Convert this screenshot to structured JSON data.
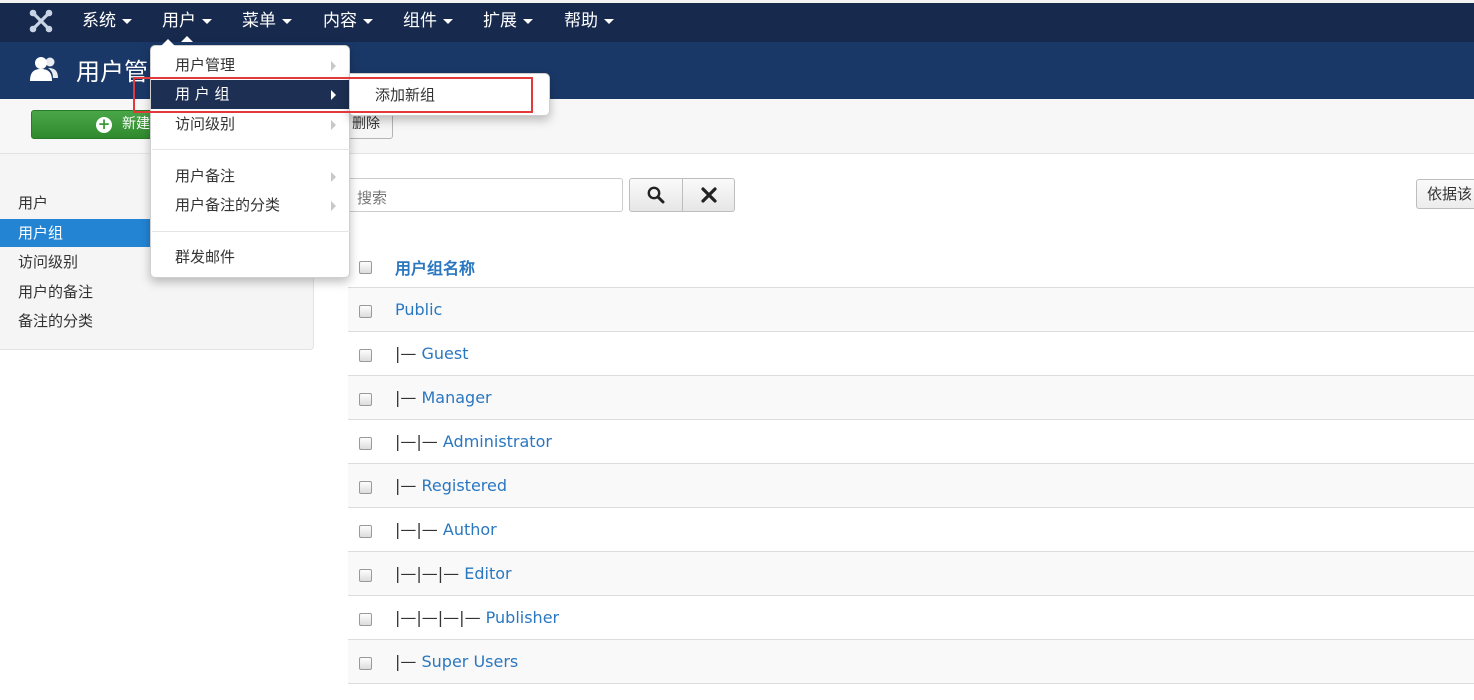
{
  "navbar": {
    "logo_icon": "joomla-logo-icon",
    "items": [
      {
        "label": "系统"
      },
      {
        "label": "用户"
      },
      {
        "label": "菜单"
      },
      {
        "label": "内容"
      },
      {
        "label": "组件"
      },
      {
        "label": "扩展"
      },
      {
        "label": "帮助"
      }
    ],
    "open_item": "用户"
  },
  "header": {
    "icon": "users-icon",
    "title": "用户管"
  },
  "toolbar": {
    "new_label": "新建",
    "delete_label": "删除"
  },
  "sidebar": {
    "items": [
      {
        "label": "用户"
      },
      {
        "label": "用户组",
        "active": true
      },
      {
        "label": "访问级别"
      },
      {
        "label": "用户的备注"
      },
      {
        "label": "备注的分类"
      }
    ]
  },
  "search": {
    "placeholder": "搜索",
    "sort_label": "依据该"
  },
  "table": {
    "column_title": "用户组名称",
    "rows": [
      {
        "prefix": "",
        "name": "Public"
      },
      {
        "prefix": "|— ",
        "name": "Guest"
      },
      {
        "prefix": "|— ",
        "name": "Manager"
      },
      {
        "prefix": "|—|— ",
        "name": "Administrator"
      },
      {
        "prefix": "|— ",
        "name": "Registered"
      },
      {
        "prefix": "|—|— ",
        "name": "Author"
      },
      {
        "prefix": "|—|—|— ",
        "name": "Editor"
      },
      {
        "prefix": "|—|—|—|— ",
        "name": "Publisher"
      },
      {
        "prefix": "|— ",
        "name": "Super Users"
      }
    ]
  },
  "dropdown": {
    "items": [
      {
        "label": "用户管理",
        "has_submenu": true
      },
      {
        "label": "用 户 组",
        "has_submenu": true,
        "active": true
      },
      {
        "label": "访问级别",
        "has_submenu": true
      },
      {
        "label": "用户备注",
        "has_submenu": true
      },
      {
        "label": "用户备注的分类",
        "has_submenu": true
      },
      {
        "label": "群发邮件",
        "has_submenu": false
      }
    ],
    "submenu": {
      "items": [
        {
          "label": "添加新组"
        }
      ]
    }
  },
  "colors": {
    "navbar_bg": "#17294d",
    "header_bg": "#1a3867",
    "active_blue": "#2384d3",
    "link_blue": "#2a77c0",
    "new_button_green": "#3a9a38",
    "highlight_red": "#e03a3a"
  }
}
